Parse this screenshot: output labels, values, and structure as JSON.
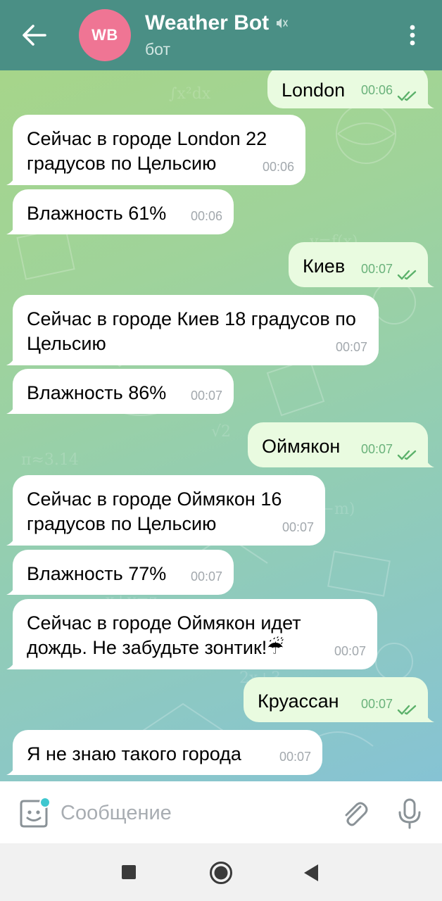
{
  "header": {
    "avatar_initials": "WB",
    "title": "Weather Bot",
    "subtitle": "бот",
    "avatar_color": "#ef7594",
    "bar_color": "#4a8f85"
  },
  "messages": [
    {
      "dir": "out",
      "text": "London",
      "time": "00:06"
    },
    {
      "dir": "in",
      "text": "Сейчас в городе London 22 градусов по Цельсию",
      "time": "00:06"
    },
    {
      "dir": "in",
      "text": "Влажность 61%",
      "time": "00:06"
    },
    {
      "dir": "out",
      "text": "Киев",
      "time": "00:07"
    },
    {
      "dir": "in",
      "text": "Сейчас в городе Киев 18 градусов по Цельсию",
      "time": "00:07"
    },
    {
      "dir": "in",
      "text": "Влажность 86%",
      "time": "00:07"
    },
    {
      "dir": "out",
      "text": "Оймякон",
      "time": "00:07"
    },
    {
      "dir": "in",
      "text": "Сейчас в городе Оймякон 16 градусов по Цельсию",
      "time": "00:07"
    },
    {
      "dir": "in",
      "text": "Влажность 77%",
      "time": "00:07"
    },
    {
      "dir": "in",
      "text": "Сейчас в городе Оймякон идет дождь. Не забудьте зонтик!☔",
      "time": "00:07"
    },
    {
      "dir": "out",
      "text": "Круассан",
      "time": "00:07"
    },
    {
      "dir": "in",
      "text": "Я не знаю такого города",
      "time": "00:07"
    }
  ],
  "input": {
    "placeholder": "Сообщение"
  },
  "icons": [
    "back-arrow-icon",
    "mute-icon",
    "more-vertical-icon",
    "sticker-icon",
    "attach-icon",
    "mic-icon",
    "nav-recents-icon",
    "nav-home-icon",
    "nav-back-icon"
  ]
}
